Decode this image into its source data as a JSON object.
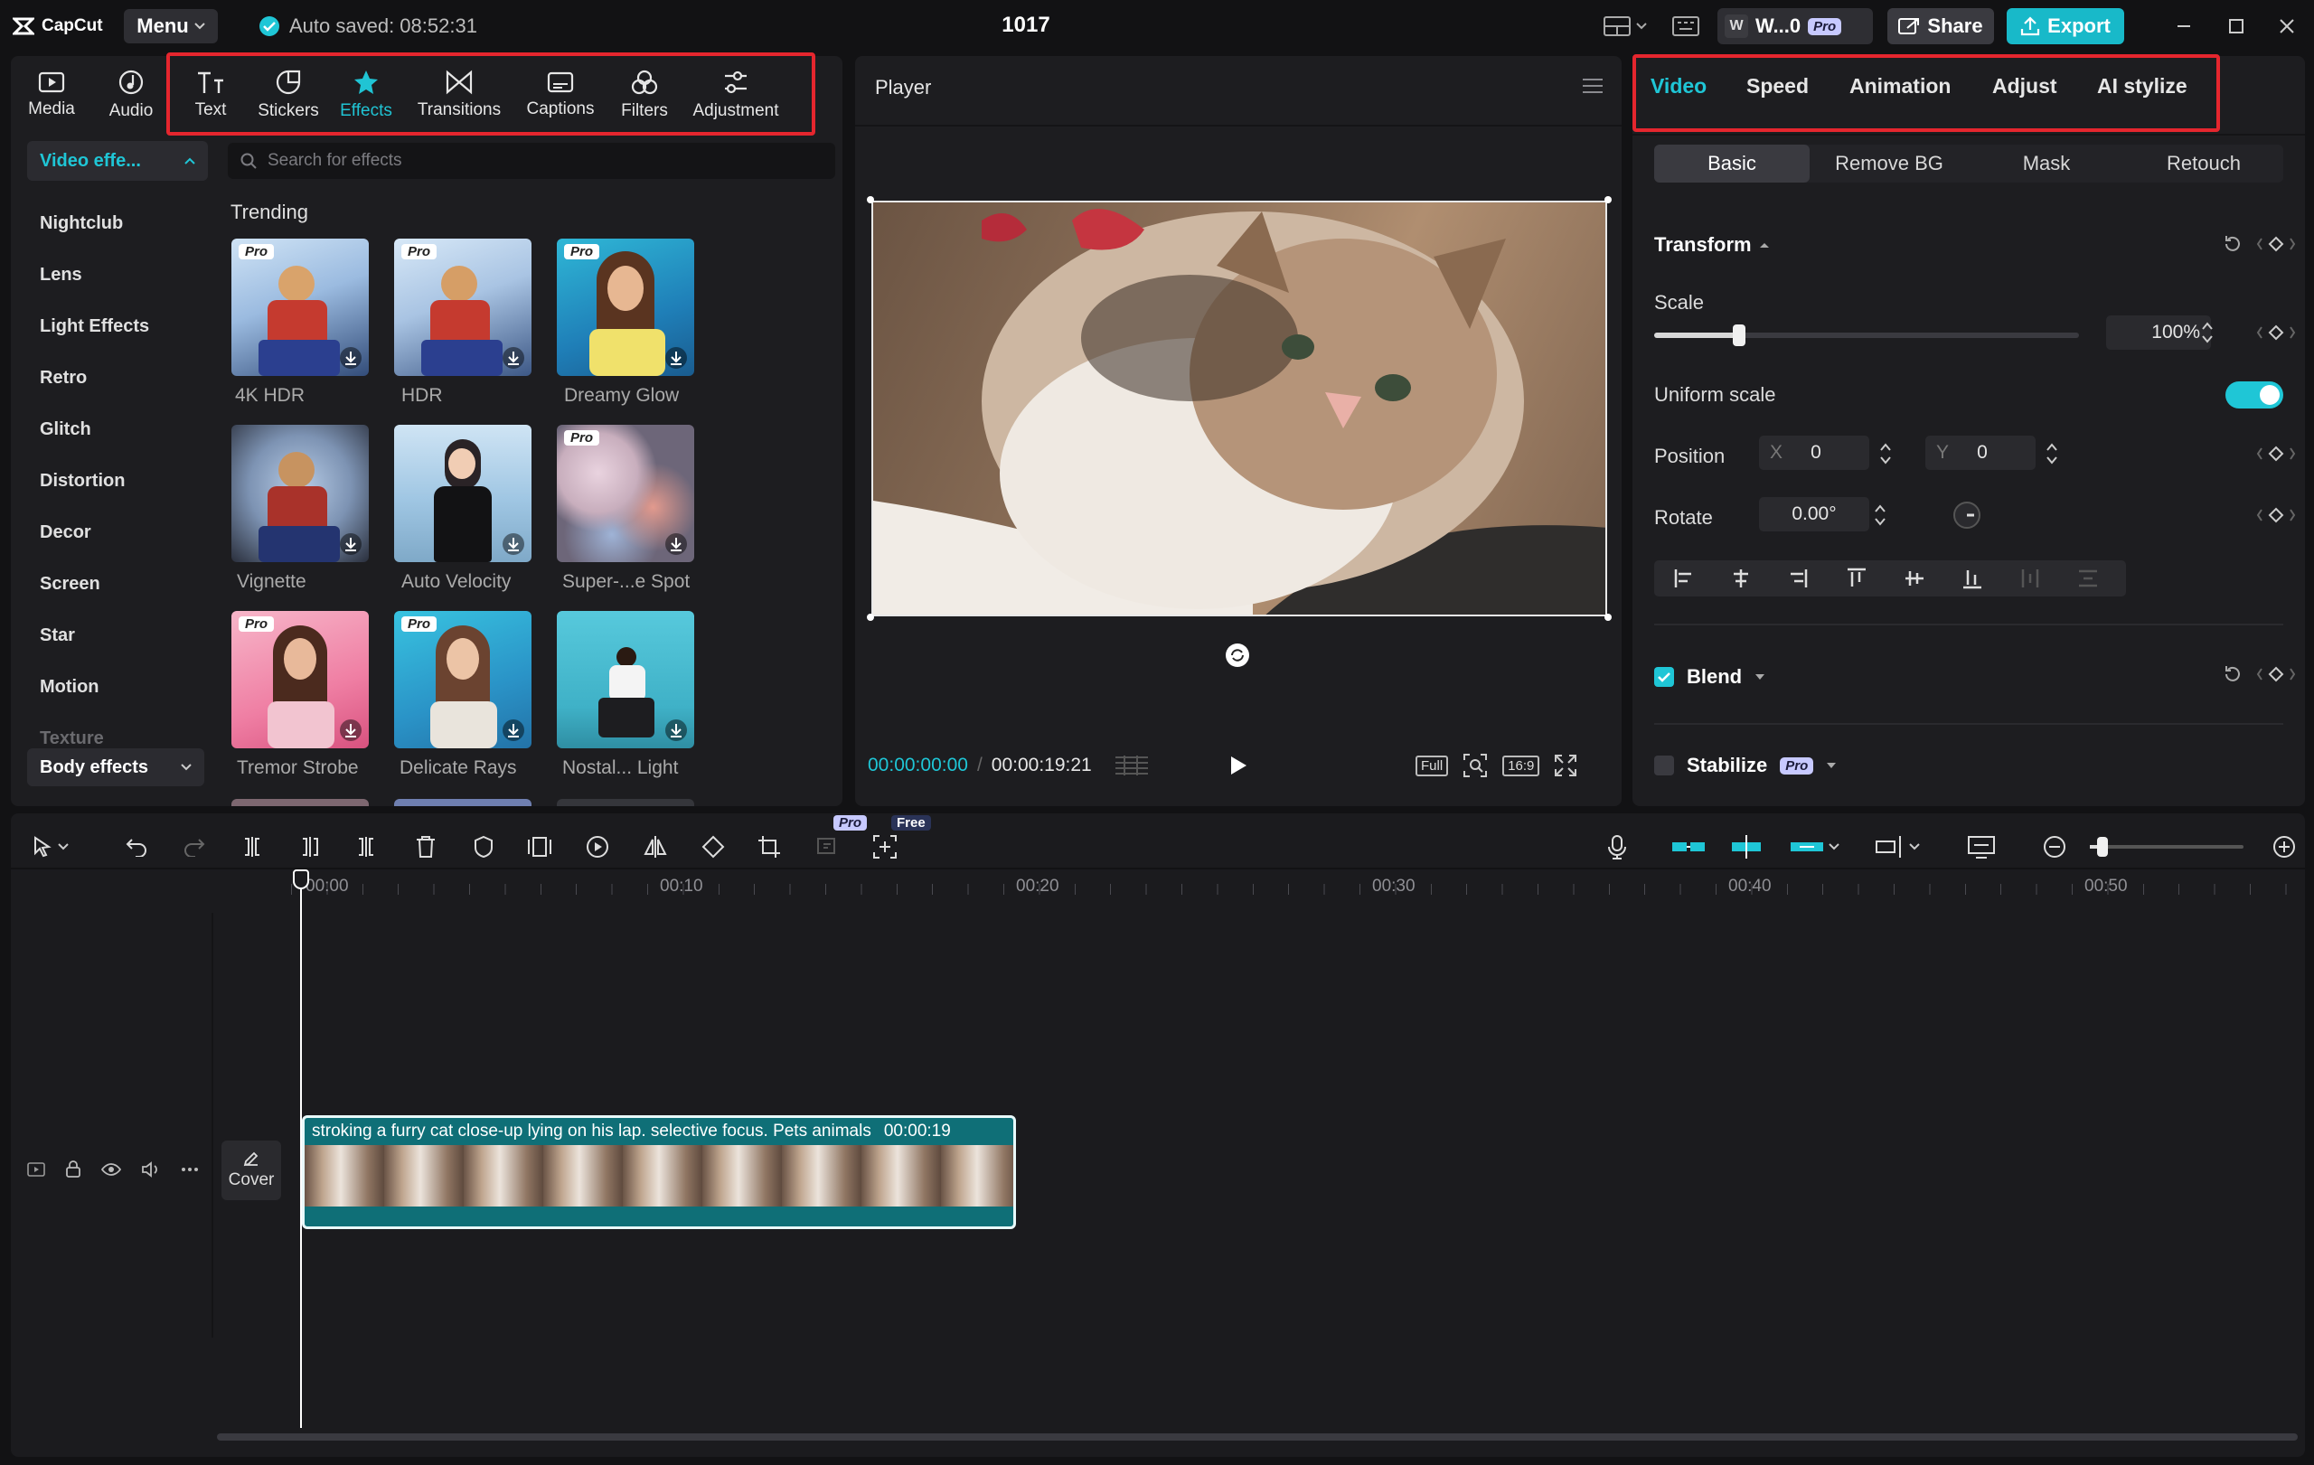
{
  "app": {
    "name": "CapCut",
    "menu_label": "Menu",
    "autosave": "Auto saved: 08:52:31",
    "project_title": "1017"
  },
  "titlebar": {
    "user_initial": "W",
    "user_name": "W...0",
    "pro_badge": "Pro",
    "share_label": "Share",
    "export_label": "Export"
  },
  "colors": {
    "accent": "#1fc6d6",
    "highlight_box": "#e5262e",
    "background": "#121214",
    "panel": "#1d1d20"
  },
  "tools": [
    {
      "label": "Media",
      "icon": "media-icon"
    },
    {
      "label": "Audio",
      "icon": "audio-icon"
    },
    {
      "label": "Text",
      "icon": "text-icon"
    },
    {
      "label": "Stickers",
      "icon": "sticker-icon"
    },
    {
      "label": "Effects",
      "icon": "effects-icon",
      "active": true
    },
    {
      "label": "Transitions",
      "icon": "transitions-icon"
    },
    {
      "label": "Captions",
      "icon": "captions-icon"
    },
    {
      "label": "Filters",
      "icon": "filters-icon"
    },
    {
      "label": "Adjustment",
      "icon": "adjustment-icon"
    }
  ],
  "categories": {
    "header": "Video effe...",
    "items": [
      "Nightclub",
      "Lens",
      "Light Effects",
      "Retro",
      "Glitch",
      "Distortion",
      "Decor",
      "Screen",
      "Star",
      "Motion",
      "Texture"
    ],
    "footer": "Body effects"
  },
  "search": {
    "placeholder": "Search for effects"
  },
  "effects": {
    "section_title": "Trending",
    "items": [
      {
        "label": "4K HDR",
        "pro": "Pro"
      },
      {
        "label": "HDR",
        "pro": "Pro"
      },
      {
        "label": "Dreamy Glow",
        "pro": "Pro"
      },
      {
        "label": "Vignette",
        "pro": ""
      },
      {
        "label": "Auto Velocity",
        "pro": ""
      },
      {
        "label": "Super-...e Spot",
        "pro": "Pro"
      },
      {
        "label": "Tremor Strobe",
        "pro": "Pro"
      },
      {
        "label": "Delicate Rays",
        "pro": "Pro"
      },
      {
        "label": "Nostal... Light",
        "pro": ""
      }
    ]
  },
  "player": {
    "title": "Player",
    "current_time": "00:00:00:00",
    "total_time": "00:00:19:21",
    "full_label": "Full",
    "ratio_label": "16:9"
  },
  "properties": {
    "tabs": [
      "Video",
      "Speed",
      "Animation",
      "Adjust",
      "AI stylize"
    ],
    "subtabs": [
      "Basic",
      "Remove BG",
      "Mask",
      "Retouch"
    ],
    "transform_label": "Transform",
    "scale_label": "Scale",
    "scale_value": "100%",
    "scale_level": 0.2,
    "uniform_scale_label": "Uniform scale",
    "uniform_scale_on": true,
    "position_label": "Position",
    "pos_x_label": "X",
    "pos_x": "0",
    "pos_y_label": "Y",
    "pos_y": "0",
    "rotate_label": "Rotate",
    "rotate_value": "0.00°",
    "blend_label": "Blend",
    "stabilize_label": "Stabilize",
    "stabilize_badge": "Pro"
  },
  "timeline": {
    "badges": {
      "pro": "Pro",
      "free": "Free"
    },
    "ruler": [
      "00:00",
      "00:10",
      "00:20",
      "00:30",
      "00:40",
      "00:50"
    ],
    "cover_label": "Cover",
    "clip": {
      "title": "stroking a furry cat close-up lying on his lap. selective focus. Pets animals",
      "duration": "00:00:19"
    }
  }
}
